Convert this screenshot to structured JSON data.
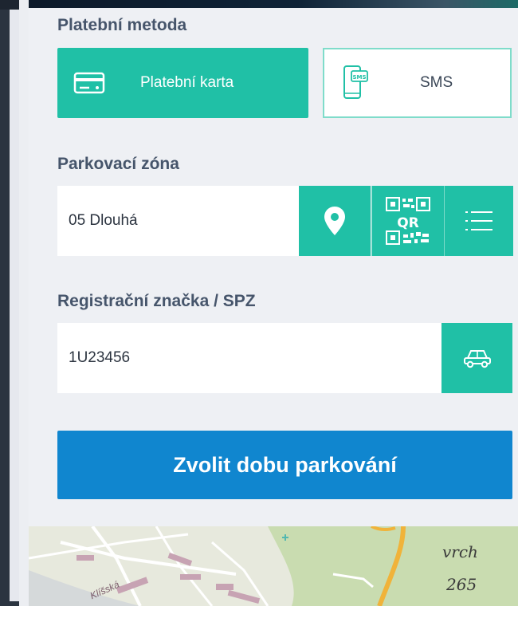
{
  "payment": {
    "section_label": "Platební metoda",
    "options": [
      {
        "label": "Platební karta",
        "icon": "credit-card-icon",
        "selected": true
      },
      {
        "label": "SMS",
        "icon": "sms-phone-icon",
        "selected": false
      }
    ]
  },
  "zone": {
    "section_label": "Parkovací zóna",
    "value": "05 Dlouhá",
    "actions": [
      {
        "icon": "location-pin-icon"
      },
      {
        "icon": "qr-code-icon",
        "text": "QR"
      },
      {
        "icon": "list-icon"
      }
    ]
  },
  "plate": {
    "section_label": "Registrační značka / SPZ",
    "value": "1U23456",
    "action_icon": "car-icon"
  },
  "submit": {
    "label": "Zvolit dobu parkování"
  },
  "map": {
    "labels": [
      "vrch",
      "265",
      "Klíšská"
    ]
  },
  "colors": {
    "accent": "#20c0a6",
    "primary": "#1086cf",
    "label": "#46556b"
  }
}
